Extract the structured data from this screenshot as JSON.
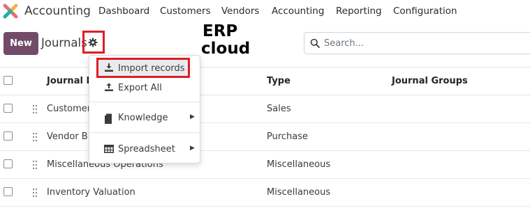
{
  "app": {
    "name": "Accounting"
  },
  "nav": {
    "items": [
      "Dashboard",
      "Customers",
      "Vendors",
      "Accounting",
      "Reporting",
      "Configuration"
    ]
  },
  "control": {
    "new_label": "New",
    "title": "Journals",
    "search_placeholder": "Search..."
  },
  "logo": {
    "text_line1": "ERP",
    "text_line2": "cloud"
  },
  "table": {
    "columns": [
      "Journal Name",
      "Type",
      "Journal Groups"
    ],
    "rows": [
      {
        "name": "Customer Invoices",
        "type": "Sales",
        "groups": ""
      },
      {
        "name": "Vendor Bills",
        "type": "Purchase",
        "groups": ""
      },
      {
        "name": "Miscellaneous Operations",
        "type": "Miscellaneous",
        "groups": ""
      },
      {
        "name": "Inventory Valuation",
        "type": "Miscellaneous",
        "groups": ""
      }
    ]
  },
  "dropdown": {
    "import_label": "Import records",
    "export_label": "Export All",
    "knowledge_label": "Knowledge",
    "spreadsheet_label": "Spreadsheet"
  },
  "colors": {
    "brand": "#714b67",
    "highlight": "#e11d24"
  },
  "icons": [
    "app-logo-icon",
    "gear-icon",
    "search-icon",
    "download-icon",
    "upload-icon",
    "knowledge-icon",
    "spreadsheet-icon",
    "drag-handle-icon"
  ]
}
